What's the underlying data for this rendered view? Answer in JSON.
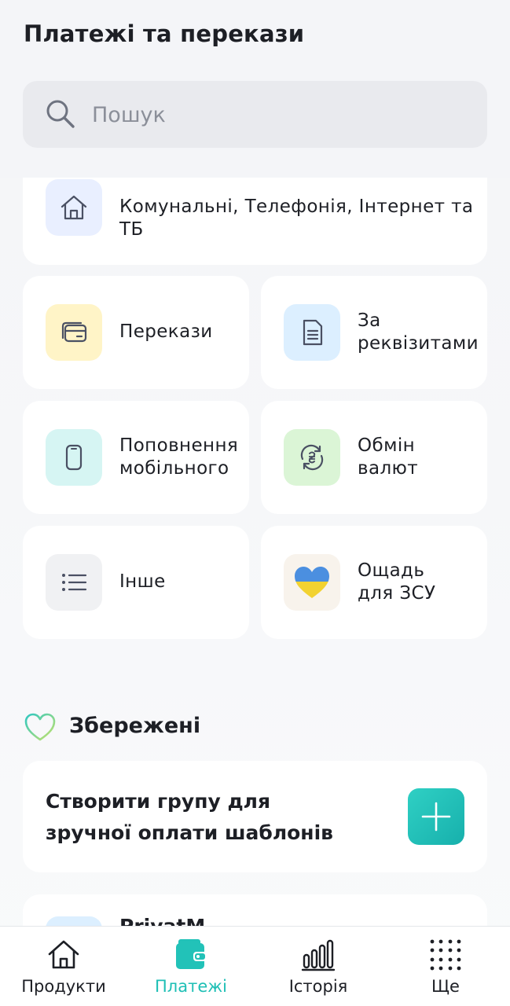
{
  "header": {
    "title": "Платежі та перекази",
    "search_placeholder": "Пошук"
  },
  "categories": {
    "utilities": "Комунальні, Телефонія, Інтернет та ТБ",
    "transfers": "Перекази",
    "requisites": "За реквізитами",
    "mobile": "Поповнення мобільного",
    "exchange": "Обмін валют",
    "other": "Інше",
    "zsu": "Ощадь для ЗСУ"
  },
  "saved": {
    "title": "Збережені",
    "create_group_text": "Створити групу для зручної оплати шаблонів",
    "partial_item_label": "PrivatM"
  },
  "icons": {
    "search": "search-icon",
    "utilities": "house-icon",
    "transfers": "cards-icon",
    "requisites": "document-icon",
    "mobile": "phone-icon",
    "exchange": "currency-exchange-icon",
    "other": "list-icon",
    "zsu": "ukraine-heart-icon",
    "saved": "heart-outline-icon",
    "add": "plus-icon"
  },
  "tabs": [
    {
      "label": "Продукти",
      "icon": "home-icon",
      "active": false
    },
    {
      "label": "Платежі",
      "icon": "wallet-icon",
      "active": true
    },
    {
      "label": "Історія",
      "icon": "bar-chart-icon",
      "active": false
    },
    {
      "label": "Ще",
      "icon": "dots-grid-icon",
      "active": false
    }
  ],
  "colors": {
    "accent": "#1ebfb5",
    "background": "#f4f5f8",
    "card": "#ffffff",
    "text": "#1d1f25",
    "placeholder": "#8b8f99"
  }
}
